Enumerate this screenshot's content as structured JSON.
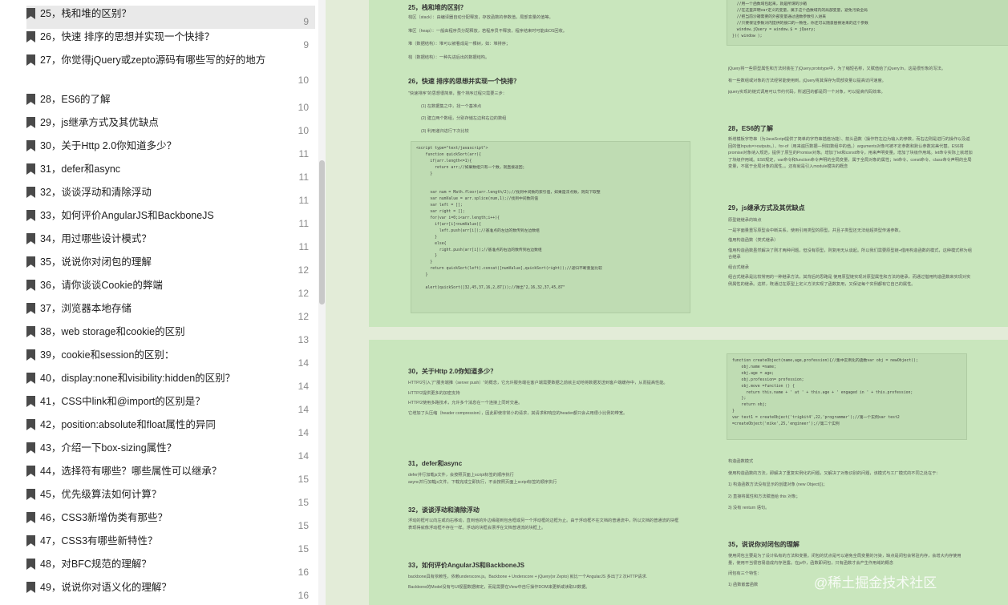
{
  "sidebar": {
    "items": [
      {
        "label": "25，栈和堆的区别？",
        "page": "9"
      },
      {
        "label": "26，快速 排序的思想并实现一个快排？",
        "page": "9"
      },
      {
        "label": "27，你觉得jQuery或zepto源码有哪些写的好的地方",
        "page": "10"
      },
      {
        "label": "28，ES6的了解",
        "page": "10"
      },
      {
        "label": "29，js继承方式及其优缺点",
        "page": "10"
      },
      {
        "label": "30，关于Http 2.0你知道多少？",
        "page": "11"
      },
      {
        "label": "31，defer和async",
        "page": "11"
      },
      {
        "label": "32，谈谈浮动和清除浮动",
        "page": "11"
      },
      {
        "label": "33，如何评价AngularJS和BackboneJS",
        "page": "11"
      },
      {
        "label": "34，用过哪些设计模式？",
        "page": "11"
      },
      {
        "label": "35，说说你对闭包的理解",
        "page": "12"
      },
      {
        "label": "36，请你谈谈Cookie的弊端",
        "page": "12"
      },
      {
        "label": "37，浏览器本地存储",
        "page": "12"
      },
      {
        "label": "38，web storage和cookie的区别",
        "page": "13"
      },
      {
        "label": "39，cookie和session的区别：",
        "page": "14"
      },
      {
        "label": "40，display:none和visibility:hidden的区别？",
        "page": "14"
      },
      {
        "label": "41，CSS中link和@import的区别是？",
        "page": "14"
      },
      {
        "label": "42，position:absolute和float属性的异同",
        "page": "14"
      },
      {
        "label": "43，介绍一下box-sizing属性？",
        "page": "14"
      },
      {
        "label": "44，选择符有哪些？哪些属性可以继承？",
        "page": "15"
      },
      {
        "label": "45，优先级算法如何计算？",
        "page": "15"
      },
      {
        "label": "46，CSS3新增伪类有那些？",
        "page": "15"
      },
      {
        "label": "47，CSS3有哪些新特性？",
        "page": "15"
      },
      {
        "label": "48，对BFC规范的理解？",
        "page": "16"
      },
      {
        "label": "49，说说你对语义化的理解？",
        "page": "16"
      }
    ]
  },
  "page1": {
    "h25": "25，栈和堆的区别？",
    "p25": [
      "栈区（stack）：由编译器自动分配释放，存放函数的参数值，局部变量的值等。",
      "堆区（heap）：一般由程序员分配释放，若程序员不释放，程序结束时可能由OS回收。",
      "堆（数据结构）：堆可以被看成是一棵树，如：堆排序；",
      "栈（数据结构）：一种先进后出的数据结构。"
    ],
    "h26": "26，快速 排序的思想并实现一个快排？",
    "p26": [
      "\"快速排序\"的思想很简单，整个排序过程只需要三步：",
      "(1) 在数据集之中，找一个基准点",
      "(2) 建立两个数组，分别存储左边和右边的数组",
      "(3) 利用递归进行下次比较"
    ],
    "code": "<script type=\"text/javascript\">\n    function quickSort(arr){\n      if(arr.length<=1){\n        return arr;//如果数组只有一个数，就直接返回；\n      }\n\n\n      var num = Math.floor(arr.length/2);//找到中间数的索引值，如果是浮点数，则向下取整\n      var numValue = arr.splice(num,1);//找到中间数的值\n      var left = [];\n      var right = [];\n      for(var i=0;i<arr.length;i++){\n        if(arr[i]<numValue){\n          left.push(arr[i]);//基准点的左边的数传到左边数组\n        }\n        else{\n          right.push(arr[i]);//基准点的右边的数传到右边数组\n        }\n      }\n      return quickSort(left).concat([numValue],quickSort(right));//递归不断重复比较\n    }\n\n    alert(quickSort([32,45,37,16,2,87]));//弹出\"2,16,32,37,45,87\"",
    "topcode": "  //用一个函数域包起来，就是所谓的沙箱\n  //在这里声明var定义的变量，属于这个函数域内的局部变量，避免污染全局\n  //把当前沙箱需要的外部变量通过函数参数引入进来\n  //只要保证参数对内提供的接口的一致性，你还可以随意替换进来的这个参数\n  window.jQuery = window.$ = jQuery;\n})( window );",
    "p27": [
      "jQuery将一些原型属性和方法封装在了jQuery.prototype中，为了缩短名称，又赋值给了jQuery.fn，这是很形象的写法。",
      "有一些数组或对象的方法经常能使用到，jQuery将其保存为局部变量以提高访问速度。",
      "jquery实现的链式调用可以节约代码，所返回的都是同一个对象，可以提高代码效率。"
    ],
    "h28": "28，ES6的了解",
    "p28": "新增模板字符串（为JavaScript提供了简单的字符串插值功能）、箭头函数（操作符左边为输入的参数，而右边则是进行的操作以及返回的值Inputs=>outputs。）、for-of（用来遍历数据—例如数组中的值。）arguments对象可被不定参数和默认参数完美代替。ES6将promise对象纳入规范，提供了原生的Promise对象。增加了let和const命令，用来声明变量。增加了块级作用域。let命令实际上就增加了块级作用域。ES6规定，var命令和function命令声明的全局变量，属于全局对象的属性；let命令、const命令、class命令声明的全局变量，不属于全局对象的属性。。还有就是引入module模块的概念",
    "h29": "29，js继承方式及其优缺点",
    "p29": [
      "原型链继承的缺点",
      "一是字面量重写原型会中断关系，使用引用类型的原型，并且子类型还无法给超类型传递参数。",
      "借用构造函数（类式继承）",
      "借用构造函数虽然解决了刚才两种问题，但没有原型，则复用无从谈起。所以我们需要原型链+借用构造函数的模式，这种模式称为组合继承",
      "组合式继承",
      "组合式继承是比较常用的一种继承方法，其背后的思路是 使用原型链实现对原型属性和方法的继承，而通过借用构造函数来实现对实例属性的继承。这样，既通过在原型上定义方法实现了函数复用，又保证每个实例都有它自己的属性。"
    ]
  },
  "page2": {
    "h30": "30，关于Http 2.0你知道多少？",
    "p30": [
      "HTTP/2引入了\"服务端推（server push）\"的概念，它允许服务端在客户端需要数据之前就主动地将数据发送到客户端缓存中，从而提高性能。",
      "HTTP/2提供更多的加密支持",
      "HTTP/2使用多路技术，允许多个消息在一个连接上同时交差。",
      "它增加了头压缩（header compression），因此即使非常小的请求，其请求和响应的header都只会占用很小比例的带宽。"
    ],
    "h31": "31，defer和async",
    "p31": [
      "defer并行加载js文件，会按照页面上script标签的顺序执行",
      "async并行加载js文件，下载完成立即执行，不会按照页面上script标签的顺序执行"
    ],
    "h32": "32，谈谈浮动和清除浮动",
    "p32": "浮动的框可以向左或向右移动，直到他的外边缘碰到包含框或另一个浮动框的边框为止。由于浮动框不在文档的普通流中，所以文档的普通流的块框表现得就像浮动框不存在一样。浮动的块框会漂浮在文档普通流的块框上。",
    "h33": "33，如何评价AngularJS和BackboneJS",
    "p33": [
      "backbone具有依赖性，依赖underscore.js。Backbone + Underscore + jQuery(or Zepto) 就比一个AngularJS 多出了2 次HTTP请求.",
      "Backbone的Model没有与UI视图数据绑定，而是需要在View中自行操作DOM来更新或读取UI数据。"
    ],
    "code2": "function createObject(name,age,profession){//集中实例化的函数var obj = newObject();\n    obj.name =name;\n    obj.age = age;\n    obj.profession= profession;\n    obj.move =function () {\n      return this.name + ' at ' + this.age + ' engaged in ' + this.profession;\n    };\n    return obj;\n}\nvar test1 = createObject('trigkit4',22,'programmer');//第一个实例var test2\n=createObject('mike',25,'engineer');//第二个实例",
    "pctor": [
      "构造函数模式",
      "使用构造函数的方法，即解决了重复实例化的问题，又解决了对象识别的问题，该模式与工厂模式的不同之处在于：",
      "1) 构造函数方法没有显示的创建对象 (new Object())；",
      "2) 直接将属性和方法赋值给 this 对象；",
      "3) 没有 renturn 语句。"
    ],
    "h35": "35，说说你对闭包的理解",
    "p35": [
      "使用闭包主要是为了设计私有的方法和变量。闭包的优点是可以避免全局变量的污染，缺点是闭包会常驻内存，会增大内存使用量，使用不当很容易造成内存泄露。在js中，函数即闭包，只有函数才会产生作用域的概念",
      "闭包有三个特性：",
      "1) 函数嵌套函数"
    ]
  },
  "watermark": "@稀土掘金技术社区"
}
